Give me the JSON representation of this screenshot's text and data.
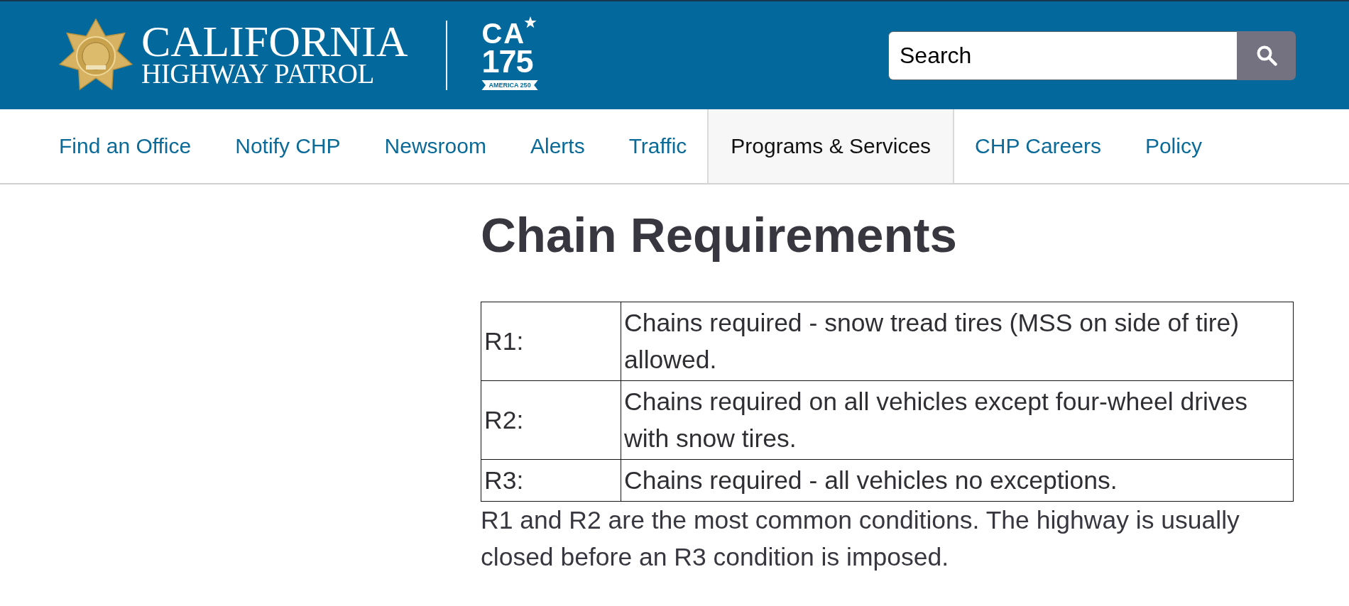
{
  "header": {
    "logo": {
      "line_1": "CALIFORNIA",
      "line_2": "HIGHWAY PATROL"
    },
    "anniversary_logo": {
      "letters": "CA",
      "number": "175",
      "ribbon": "AMERICA 250"
    },
    "search": {
      "placeholder": "Search"
    }
  },
  "nav": {
    "items": [
      {
        "label": "Find an Office",
        "selected": false
      },
      {
        "label": "Notify CHP",
        "selected": false
      },
      {
        "label": "Newsroom",
        "selected": false
      },
      {
        "label": "Alerts",
        "selected": false
      },
      {
        "label": "Traffic",
        "selected": false
      },
      {
        "label": "Programs & Services",
        "selected": true
      },
      {
        "label": "CHP Careers",
        "selected": false
      },
      {
        "label": "Policy",
        "selected": false
      }
    ]
  },
  "main": {
    "title": "Chain Requirements",
    "table": {
      "rows": [
        {
          "code": "R1:",
          "description": "Chains required - snow tread tires (MSS on side of tire) allowed."
        },
        {
          "code": "R2:",
          "description": "Chains required on all vehicles except four-wheel drives with snow tires."
        },
        {
          "code": "R3:",
          "description": "Chains required - all vehicles no exceptions."
        }
      ]
    },
    "note": "R1 and R2 are the most common conditions. The highway is usually closed before an R3 condition is imposed."
  }
}
